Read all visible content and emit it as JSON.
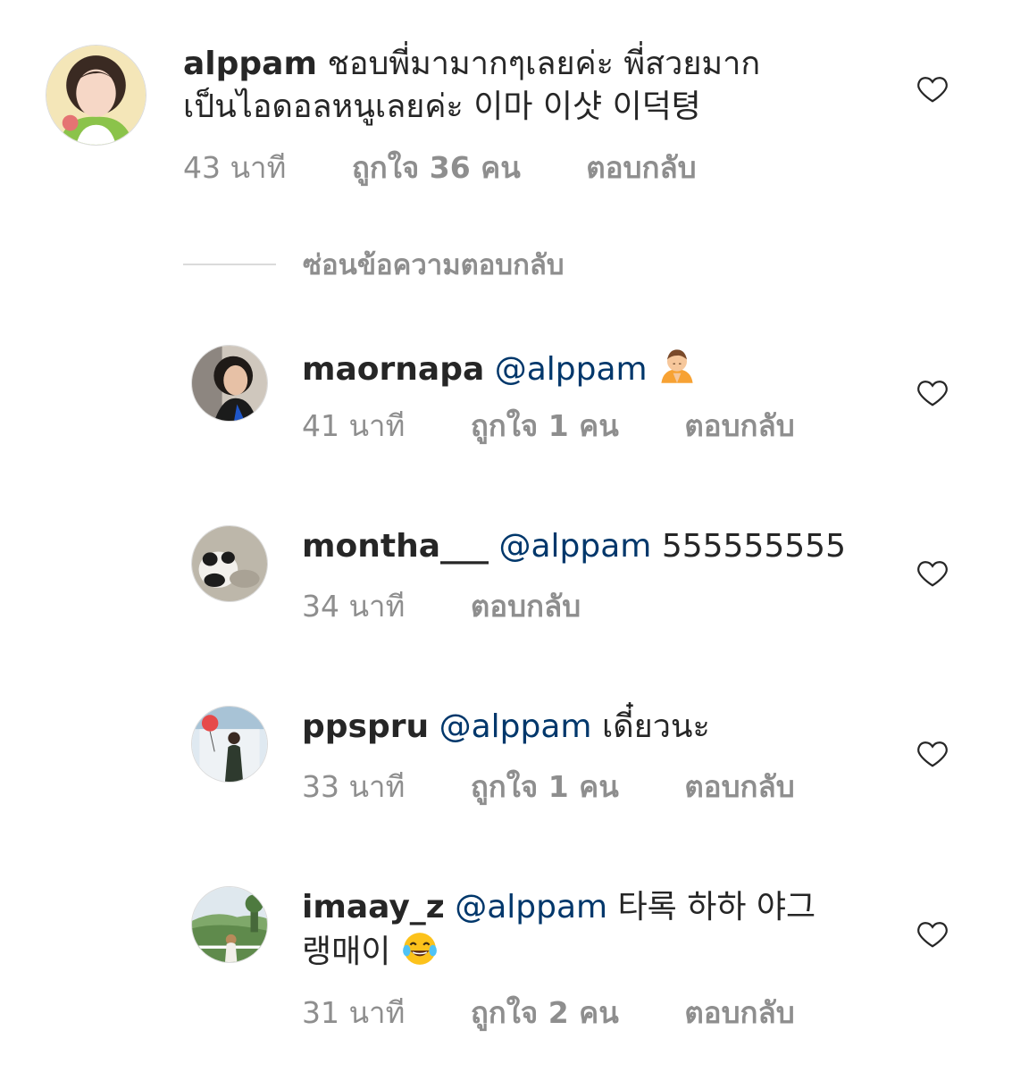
{
  "main_comment": {
    "username": "alppam",
    "text_line1": "ชอบพี่มามากๆเลยค่ะ พี่สวยมาก",
    "text_line2": "เป็นไอดอลหนูเลยค่ะ 이마 이샷 이덕텽",
    "time": "43 นาที",
    "likes": "ถูกใจ 36 คน",
    "reply": "ตอบกลับ"
  },
  "hide_replies_label": "ซ่อนข้อความตอบกลับ",
  "replies": [
    {
      "username": "maornapa",
      "mention": "@alppam",
      "text": "",
      "emoji": "person-bowing-emoji",
      "time": "41 นาที",
      "likes": "ถูกใจ 1 คน",
      "reply": "ตอบกลับ"
    },
    {
      "username": "montha___",
      "mention": "@alppam",
      "text": "555555555",
      "time": "34 นาที",
      "likes": "",
      "reply": "ตอบกลับ"
    },
    {
      "username": "ppspru",
      "mention": "@alppam",
      "text": "เดี๋ยวนะ",
      "time": "33 นาที",
      "likes": "ถูกใจ 1 คน",
      "reply": "ตอบกลับ"
    },
    {
      "username": "imaay_z",
      "mention": "@alppam",
      "text_line1": "타록 하하 야그",
      "text_line2": "랭매이",
      "emoji": "face-with-tears-of-joy-emoji",
      "time": "31 นาที",
      "likes": "ถูกใจ 2 คน",
      "reply": "ตอบกลับ"
    }
  ],
  "colors": {
    "text": "#262626",
    "meta": "#8e8e8e",
    "mention": "#00376b",
    "divider": "#dbdbdb"
  }
}
